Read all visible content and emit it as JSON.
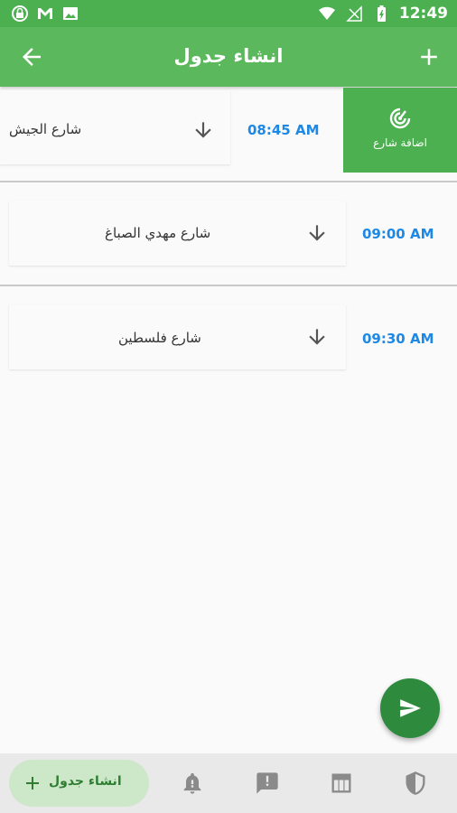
{
  "status_bar": {
    "time": "12:49",
    "icons_left": [
      "lock-globe-icon",
      "gmail-icon",
      "image-icon"
    ],
    "icons_right": [
      "wifi-icon",
      "no-signal-icon",
      "battery-icon"
    ]
  },
  "app_bar": {
    "title": "انشاء جدول",
    "back_icon": "arrow-back-icon",
    "add_icon": "plus-icon"
  },
  "swipe_action": {
    "label": "اضافة شارع",
    "icon": "radar-icon",
    "color": "#4caf50"
  },
  "rows": [
    {
      "street": "شارع الجيش",
      "time": "08:45  AM"
    },
    {
      "street": "شارع مهدي الصباغ",
      "time": "09:00  AM"
    },
    {
      "street": "شارع فلسطين",
      "time": "09:30  AM"
    }
  ],
  "fab": {
    "icon": "send-icon"
  },
  "bottom_nav": {
    "active_label": "انشاء جدول",
    "items": [
      "bell-icon",
      "feedback-icon",
      "table-icon",
      "shield-icon"
    ]
  },
  "colors": {
    "primary": "#5cb85c",
    "primary_dark": "#4caf50",
    "accent": "#2e8b3e",
    "time_text": "#1e88e5"
  }
}
